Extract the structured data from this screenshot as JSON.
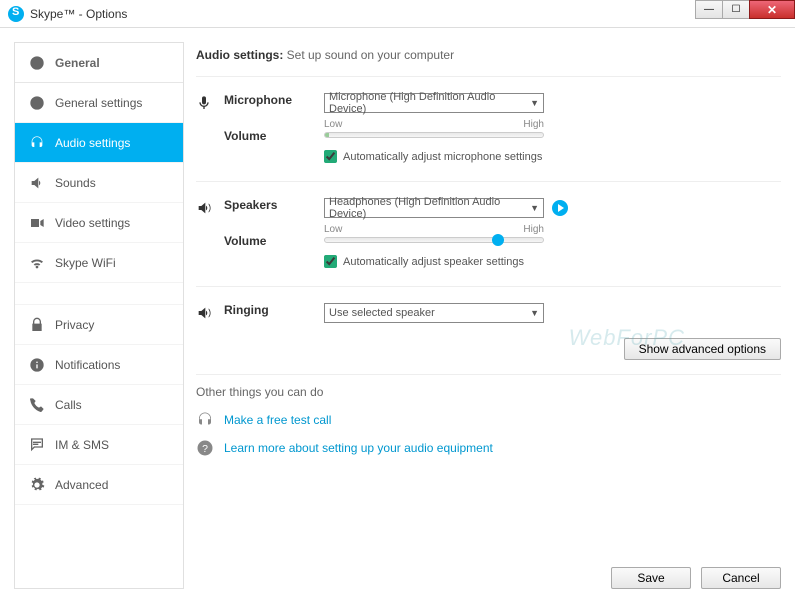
{
  "window": {
    "title": "Skype™ - Options"
  },
  "sidebar": {
    "items": [
      {
        "label": "General",
        "icon": "skype",
        "header": true
      },
      {
        "label": "General settings",
        "icon": "skype"
      },
      {
        "label": "Audio settings",
        "icon": "headset",
        "active": true
      },
      {
        "label": "Sounds",
        "icon": "speaker"
      },
      {
        "label": "Video settings",
        "icon": "camera"
      },
      {
        "label": "Skype WiFi",
        "icon": "wifi"
      },
      {
        "label": "Privacy",
        "icon": "lock"
      },
      {
        "label": "Notifications",
        "icon": "info"
      },
      {
        "label": "Calls",
        "icon": "phone"
      },
      {
        "label": "IM & SMS",
        "icon": "chat"
      },
      {
        "label": "Advanced",
        "icon": "gear"
      }
    ]
  },
  "header": {
    "bold": "Audio settings:",
    "rest": " Set up sound on your computer"
  },
  "mic": {
    "label": "Microphone",
    "volume_label": "Volume",
    "device": "Microphone (High Definition Audio Device)",
    "low": "Low",
    "high": "High",
    "auto_label": "Automatically adjust microphone settings"
  },
  "spk": {
    "label": "Speakers",
    "volume_label": "Volume",
    "device": "Headphones (High Definition Audio Device)",
    "low": "Low",
    "high": "High",
    "auto_label": "Automatically adjust speaker settings"
  },
  "ring": {
    "label": "Ringing",
    "device": "Use selected speaker"
  },
  "adv_button": "Show advanced options",
  "other": {
    "header": "Other things you can do",
    "link1": "Make a free test call",
    "link2": "Learn more about setting up your audio equipment"
  },
  "footer": {
    "save": "Save",
    "cancel": "Cancel"
  },
  "watermark": "WebForPC"
}
